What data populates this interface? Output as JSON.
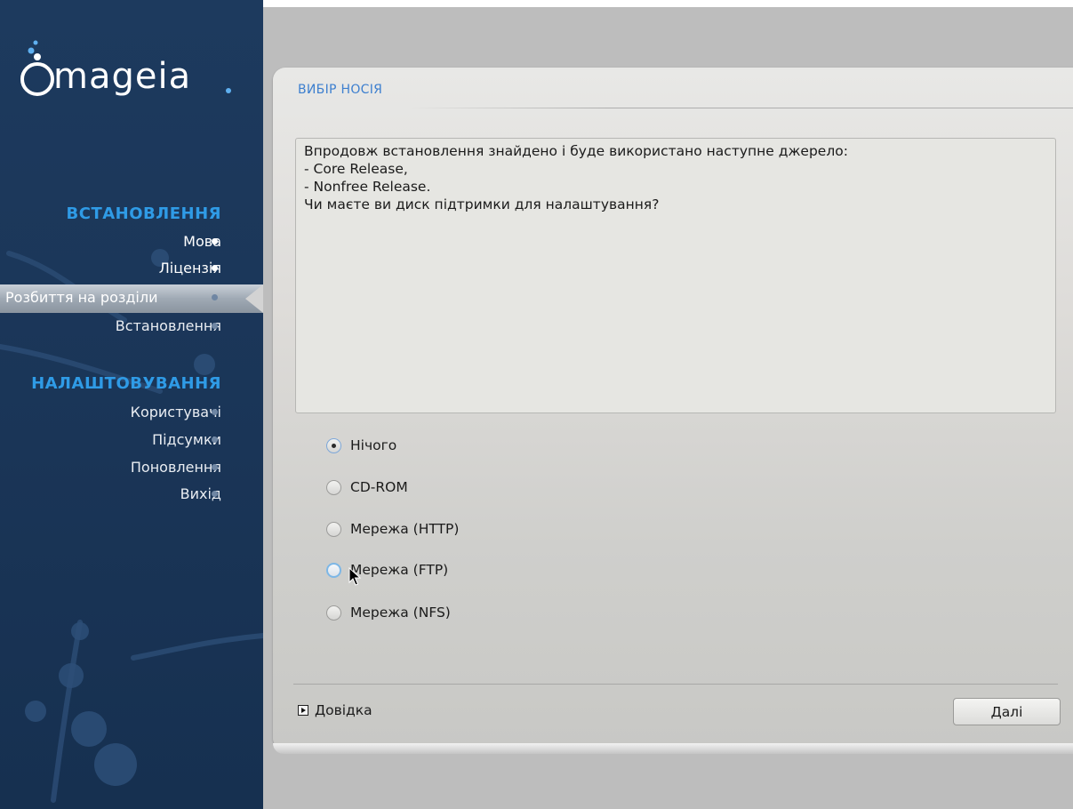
{
  "logo": {
    "text": "mageia"
  },
  "sidebar": {
    "sections": [
      {
        "title": "ВСТАНОВЛЕННЯ"
      },
      {
        "title": "НАЛАШТОВУВАННЯ"
      }
    ],
    "items": [
      {
        "label": "Мова",
        "state": "done"
      },
      {
        "label": "Ліцензія",
        "state": "done"
      },
      {
        "label": "Розбиття на розділи",
        "state": "active"
      },
      {
        "label": "Встановлення",
        "state": "pending"
      },
      {
        "label": "Користувачі",
        "state": "pending"
      },
      {
        "label": "Підсумки",
        "state": "pending"
      },
      {
        "label": "Поновлення",
        "state": "pending"
      },
      {
        "label": "Вихід",
        "state": "pending"
      }
    ]
  },
  "page": {
    "title": "ВИБІР НОСІЯ"
  },
  "message": {
    "lines": [
      "Впродовж встановлення знайдено і буде використано наступне джерело:",
      "",
      "- Core Release,",
      "- Nonfree Release.",
      "",
      "Чи маєте ви диск підтримки для налаштування?"
    ]
  },
  "options": {
    "selected_index": 0,
    "hovered_index": 3,
    "items": [
      {
        "label": "Нічого"
      },
      {
        "label": "CD-ROM"
      },
      {
        "label": "Мережа (HTTP)"
      },
      {
        "label": "Мережа (FTP)"
      },
      {
        "label": "Мережа (NFS)"
      }
    ]
  },
  "footer": {
    "help_label": "Довідка",
    "next_label": "Далі"
  },
  "colors": {
    "sidebar_bg": "#1b375a",
    "section_heading": "#2f9be6",
    "title_accent": "#3d7fcf",
    "panel_bg": "#dedcd9"
  }
}
